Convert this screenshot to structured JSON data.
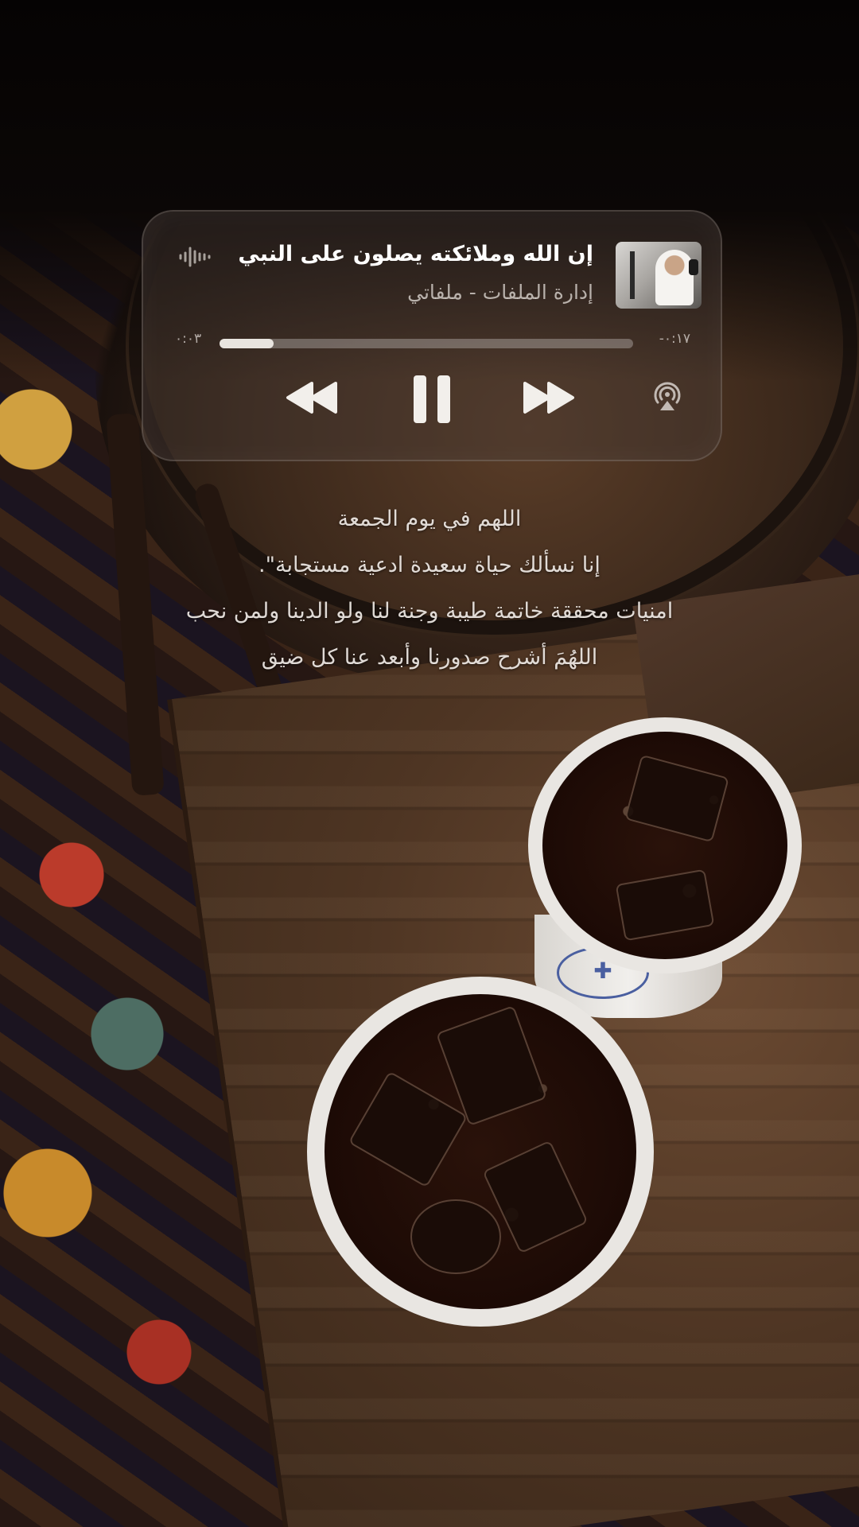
{
  "now_playing": {
    "title": "إن الله وملائكته يصلون على النبي",
    "source": "إدارة الملفات - ملفاتي",
    "elapsed": "٠:٠٣",
    "remaining": "-٠:١٧",
    "progress_fraction": 0.13,
    "icons": {
      "waveform": "waveform-icon",
      "rewind": "rewind-icon",
      "pause": "pause-icon",
      "fast_forward": "fast-forward-icon",
      "airplay": "airplay-audio-icon"
    }
  },
  "caption": {
    "lines": [
      "اللهم في يوم الجمعة",
      "إنا نسألك حياة سعيدة ادعية مستجابة\".",
      "امنيات محققة خاتمة طيبة وجنة لنا ولو الدينا ولمن نحب",
      "اللهُمَ أشرح صدورنا وأبعد عنا كل ضيق"
    ]
  }
}
